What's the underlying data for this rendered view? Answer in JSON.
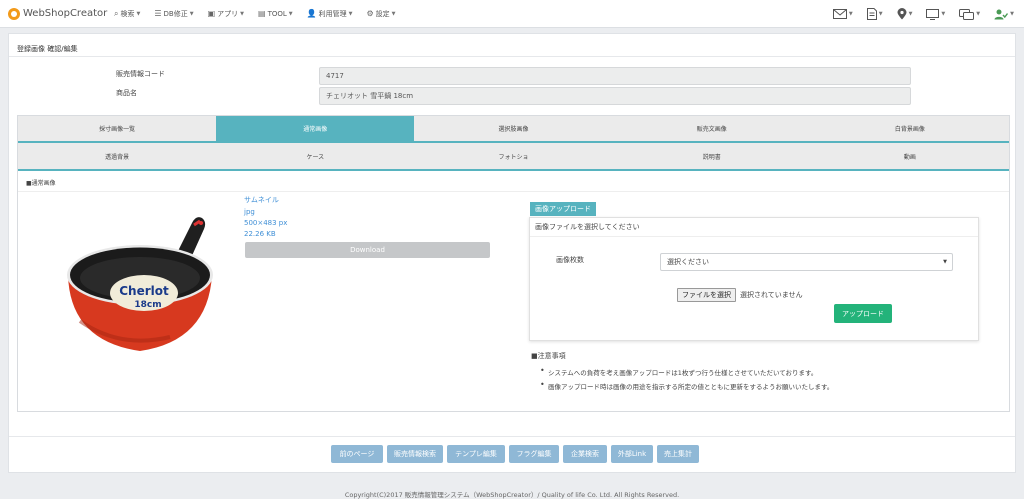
{
  "brand": {
    "title": "WebShopCreator"
  },
  "nav": [
    {
      "label": "検索",
      "icon": "search-icon"
    },
    {
      "label": "DB修正",
      "icon": "list-icon"
    },
    {
      "label": "アプリ",
      "icon": "app-icon"
    },
    {
      "label": "TOOL",
      "icon": "tool-icon"
    },
    {
      "label": "利用管理",
      "icon": "users-icon"
    },
    {
      "label": "設定",
      "icon": "gear-icon"
    }
  ],
  "page": {
    "title": "登録画像 確認/編集",
    "fields": [
      {
        "label": "販売情報コード",
        "value": "4717"
      },
      {
        "label": "商品名",
        "value": "チェリオット 雪平鍋 18cm"
      }
    ]
  },
  "tabs_row1": [
    "採寸画像一覧",
    "通常画像",
    "選択肢画像",
    "販売文画像",
    "白背景画像"
  ],
  "tabs_row2": [
    "透過背景",
    "ケース",
    "フォトショ",
    "説明書",
    "動画"
  ],
  "active_tab": "通常画像",
  "section_label": "■通常画像",
  "image_info": {
    "name": "サムネイル",
    "format": "jpg",
    "dimensions": "500×483 px",
    "size": "22.26 KB",
    "download_label": "Download"
  },
  "upload": {
    "tag": "画像アップロード",
    "prompt": "画像ファイルを選択してください",
    "count_label": "画像枚数",
    "select_value": "選択ください",
    "file_button": "ファイルを選択",
    "file_status": "選択されていません",
    "upload_button": "アップロード"
  },
  "notes": {
    "title": "■注意事項",
    "items": [
      "システムへの負荷を考え画像アップロードは1枚ずつ行う仕様とさせていただいております。",
      "画像アップロード時は画像の用途を指示する所定の値とともに更新をするようお願いいたします。"
    ]
  },
  "footer_buttons": [
    "前のページ",
    "販売情報検索",
    "テンプレ編集",
    "フラグ編集",
    "企業検索",
    "外部Link",
    "売上集計"
  ],
  "copyright": "Copyright(C)2017 販売情報管理システム（WebShopCreator）/ Quality of life Co. Ltd. All Rights Reserved.",
  "colors": {
    "accent": "#57b3bf",
    "upload_button": "#23b37a",
    "footer_button": "#8fb8d6",
    "link": "#3f8fd6"
  }
}
